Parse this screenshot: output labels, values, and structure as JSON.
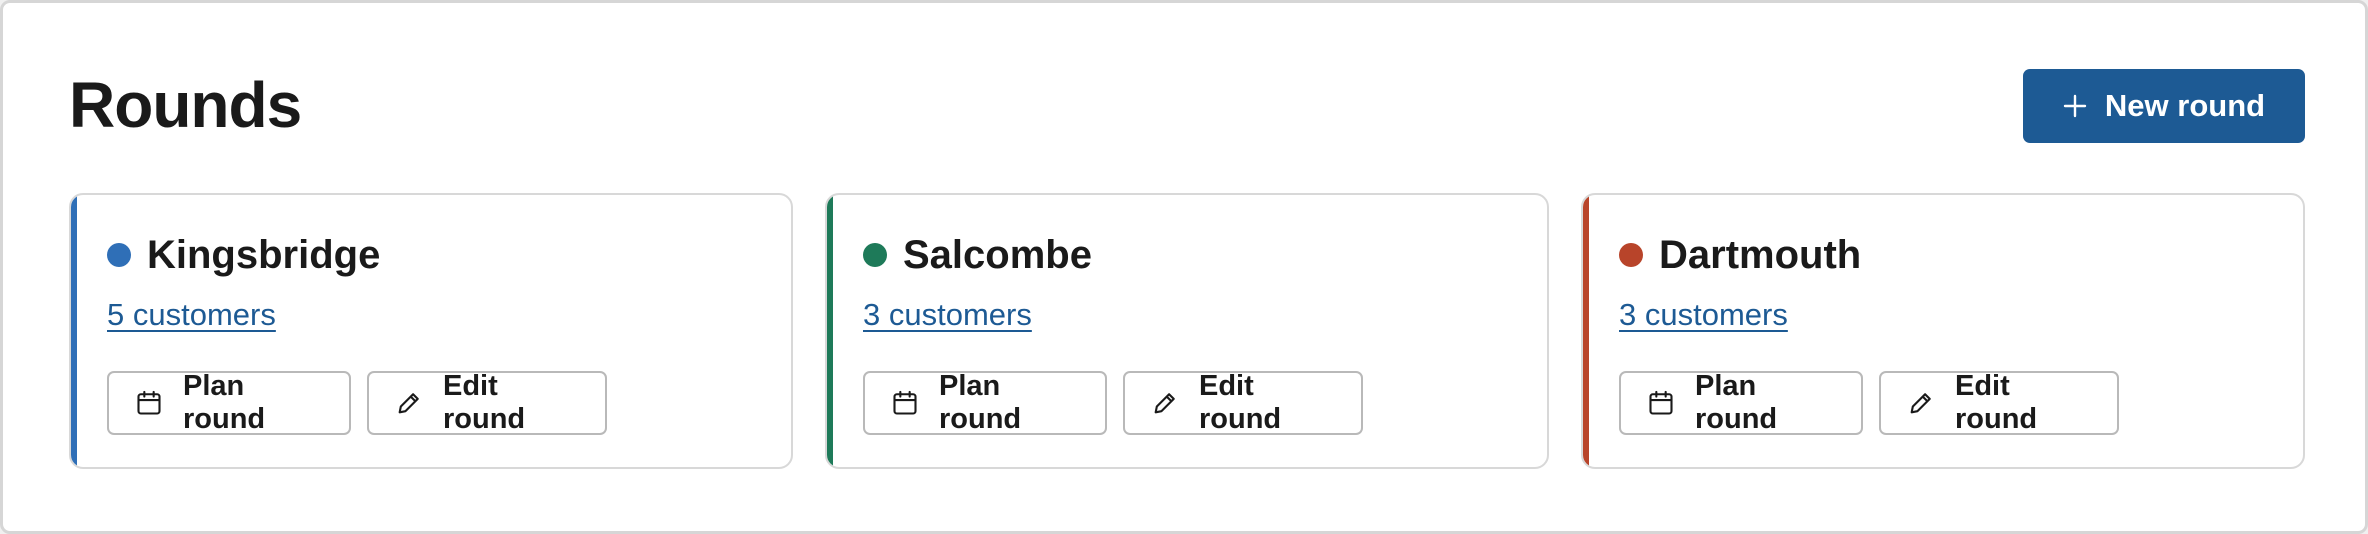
{
  "page": {
    "title": "Rounds",
    "new_button_label": "New round"
  },
  "colors": {
    "primary": "#1d5a94",
    "link": "#1d5a94"
  },
  "rounds": [
    {
      "name": "Kingsbridge",
      "customers": "5 customers",
      "color": "#2f6fb7",
      "plan_label": "Plan round",
      "edit_label": "Edit round"
    },
    {
      "name": "Salcombe",
      "customers": "3 customers",
      "color": "#1e7a59",
      "plan_label": "Plan round",
      "edit_label": "Edit round"
    },
    {
      "name": "Dartmouth",
      "customers": "3 customers",
      "color": "#b8442a",
      "plan_label": "Plan round",
      "edit_label": "Edit round"
    }
  ],
  "icons": {
    "new": "plus-icon",
    "plan": "calendar-icon",
    "edit": "pencil-icon"
  }
}
